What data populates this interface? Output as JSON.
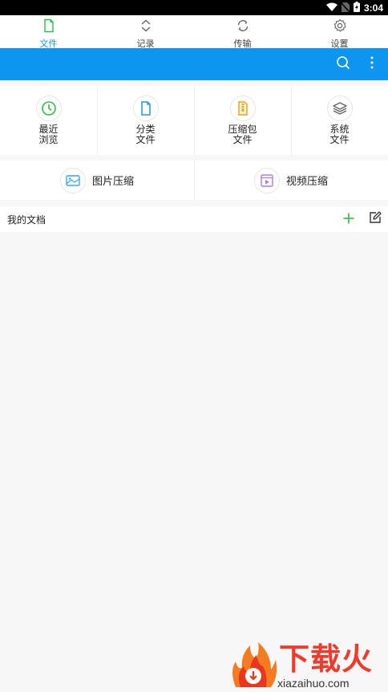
{
  "status_bar": {
    "time": "3:04"
  },
  "tabs": [
    {
      "label": "文件",
      "active": true,
      "icon": "file-icon"
    },
    {
      "label": "记录",
      "active": false,
      "icon": "updown-chevron-icon"
    },
    {
      "label": "传输",
      "active": false,
      "icon": "sync-icon"
    },
    {
      "label": "设置",
      "active": false,
      "icon": "gear-icon"
    }
  ],
  "action_bar": {
    "color": "#0e95f0",
    "search_icon": "search-icon",
    "more_icon": "more-vert-icon"
  },
  "categories": [
    {
      "label": "最近\n浏览",
      "icon": "clock-icon",
      "color": "#34b84a"
    },
    {
      "label": "分类\n文件",
      "icon": "document-icon",
      "color": "#1e95ea"
    },
    {
      "label": "压缩包\n文件",
      "icon": "archive-icon",
      "color": "#f0a21b"
    },
    {
      "label": "系统\n文件",
      "icon": "layers-icon",
      "color": "#666666"
    }
  ],
  "compress": [
    {
      "label": "图片压缩",
      "icon": "image-compress-icon",
      "color": "#39a9e8"
    },
    {
      "label": "视频压缩",
      "icon": "video-compress-icon",
      "color": "#b07be8"
    }
  ],
  "docs": {
    "title": "我的文档",
    "add_icon": "plus-icon",
    "edit_icon": "edit-icon",
    "accent": "#2dbb4a"
  },
  "watermark": {
    "title": "下载火",
    "subtitle": "xiazaihuo.com"
  }
}
